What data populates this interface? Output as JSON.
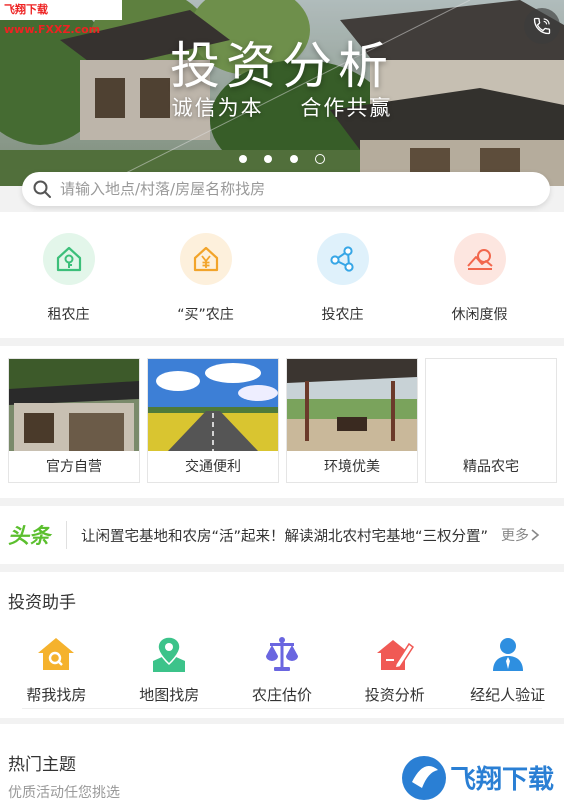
{
  "watermark": "飞翔下载 www.FXXZ.com",
  "banner": {
    "title": "投资分析",
    "subtitle_left": "诚信为本",
    "subtitle_right": "合作共赢",
    "slides": 4,
    "active_slide": 4
  },
  "search": {
    "placeholder": "请输入地点/村落/房屋名称找房"
  },
  "categories": [
    {
      "label": "租农庄",
      "icon": "house-rent-icon",
      "color": "#3cbf7a",
      "bg": "#e3f6ea"
    },
    {
      "label": "“买”农庄",
      "icon": "house-yen-icon",
      "color": "#f2a42a",
      "bg": "#fdf0dc"
    },
    {
      "label": "投农庄",
      "icon": "share-nodes-icon",
      "color": "#36a6e6",
      "bg": "#dff1fb"
    },
    {
      "label": "休闲度假",
      "icon": "landscape-icon",
      "color": "#f2674d",
      "bg": "#fde6e0"
    }
  ],
  "features": [
    {
      "label": "官方自营"
    },
    {
      "label": "交通便利"
    },
    {
      "label": "环境优美"
    },
    {
      "label": "精品农宅"
    }
  ],
  "headline": {
    "logo": "头条",
    "text": "让闲置宅基地和农房“活”起来！解读湖北农村宅基地“三权分置”",
    "more": "更多"
  },
  "helper": {
    "title": "投资助手",
    "tools": [
      {
        "label": "帮我找房",
        "icon": "house-search-icon",
        "color": "#f5b22d"
      },
      {
        "label": "地图找房",
        "icon": "map-pin-icon",
        "color": "#3cc38a"
      },
      {
        "label": "农庄估价",
        "icon": "scale-icon",
        "color": "#6a66e0"
      },
      {
        "label": "投资分析",
        "icon": "house-pen-icon",
        "color": "#f05a55"
      },
      {
        "label": "经纪人验证",
        "icon": "agent-icon",
        "color": "#2e8fe0"
      }
    ]
  },
  "hot": {
    "title": "热门主题",
    "subtitle": "优质活动任您挑选",
    "brand": "飞翔下载"
  }
}
